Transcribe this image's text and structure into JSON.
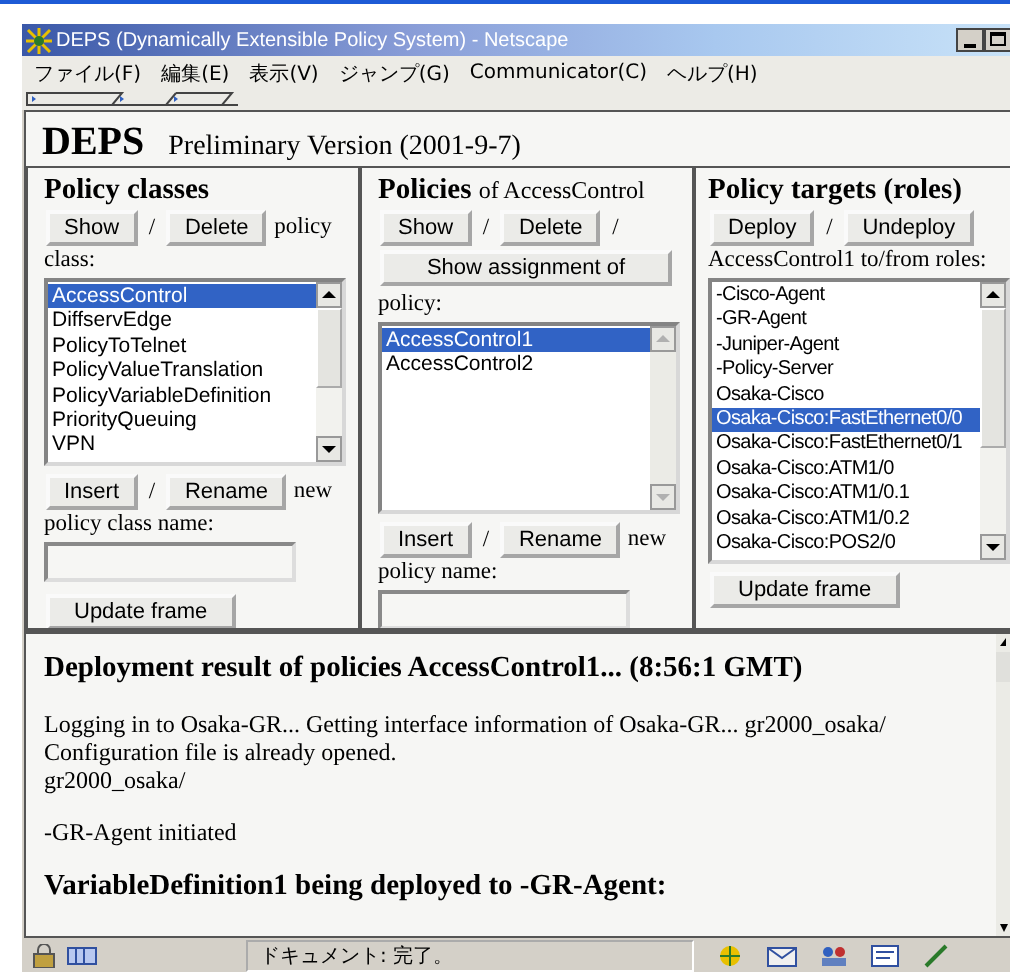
{
  "window": {
    "title": "DEPS (Dynamically Extensible Policy System) - Netscape"
  },
  "menu": [
    "ファイル(F)",
    "編集(E)",
    "表示(V)",
    "ジャンプ(G)",
    "Communicator(C)",
    "ヘルプ(H)"
  ],
  "header": {
    "title": "DEPS",
    "subtitle": "Preliminary Version (2001-9-7)"
  },
  "panels": [
    {
      "title": "Policy classes",
      "items": [
        {
          "kind": "button",
          "text": "Show"
        },
        {
          "kind": "text",
          "text": "/"
        },
        {
          "kind": "button",
          "text": "Delete"
        },
        {
          "kind": "text",
          "text": "policy"
        },
        {
          "kind": "text",
          "text": "class:"
        },
        {
          "kind": "list",
          "disabled": false,
          "items": [
            {
              "text": "AccessControl",
              "selected": true
            },
            {
              "text": "DiffservEdge",
              "selected": false
            },
            {
              "text": "PolicyToTelnet",
              "selected": false
            },
            {
              "text": "PolicyValueTranslation",
              "selected": false
            },
            {
              "text": "PolicyVariableDefinition",
              "selected": false
            },
            {
              "text": "PriorityQueuing",
              "selected": false
            },
            {
              "text": "VPN",
              "selected": false
            }
          ]
        },
        {
          "kind": "button",
          "text": "Insert"
        },
        {
          "kind": "text",
          "text": "/"
        },
        {
          "kind": "button",
          "text": "Rename"
        },
        {
          "kind": "text",
          "text": "new"
        },
        {
          "kind": "text",
          "text": "policy class name:"
        },
        {
          "kind": "field"
        },
        {
          "kind": "block-button",
          "text": "Update frame"
        }
      ]
    },
    {
      "title": "Policies",
      "title_suffix": "of AccessControl",
      "items": [
        {
          "kind": "button",
          "text": "Show"
        },
        {
          "kind": "text",
          "text": "/"
        },
        {
          "kind": "button",
          "text": "Delete"
        },
        {
          "kind": "text",
          "text": "/"
        },
        {
          "kind": "block-button",
          "text": "Show assignment of"
        },
        {
          "kind": "text",
          "text": "policy:"
        },
        {
          "kind": "list",
          "disabled": true,
          "items": [
            {
              "text": "AccessControl1",
              "selected": true
            },
            {
              "text": "AccessControl2",
              "selected": false
            }
          ]
        },
        {
          "kind": "button",
          "text": "Insert"
        },
        {
          "kind": "text",
          "text": "/"
        },
        {
          "kind": "button",
          "text": "Rename"
        },
        {
          "kind": "text",
          "text": "new"
        },
        {
          "kind": "text",
          "text": "policy name:"
        },
        {
          "kind": "field"
        }
      ]
    },
    {
      "title": "Policy targets (roles)",
      "items": [
        {
          "kind": "button",
          "text": "Deploy"
        },
        {
          "kind": "text",
          "text": "/"
        },
        {
          "kind": "button",
          "text": "Undeploy"
        },
        {
          "kind": "text",
          "text": "AccessControl1 to/from roles:"
        },
        {
          "kind": "list",
          "disabled": false,
          "items": [
            {
              "text": "-Cisco-Agent",
              "selected": false
            },
            {
              "text": "-GR-Agent",
              "selected": false
            },
            {
              "text": "-Juniper-Agent",
              "selected": false
            },
            {
              "text": "-Policy-Server",
              "selected": false
            },
            {
              "text": "Osaka-Cisco",
              "selected": false
            },
            {
              "text": "Osaka-Cisco:FastEthernet0/0",
              "selected": true
            },
            {
              "text": "Osaka-Cisco:FastEthernet0/1",
              "selected": false
            },
            {
              "text": "Osaka-Cisco:ATM1/0",
              "selected": false
            },
            {
              "text": "Osaka-Cisco:ATM1/0.1",
              "selected": false
            },
            {
              "text": "Osaka-Cisco:ATM1/0.2",
              "selected": false
            },
            {
              "text": "Osaka-Cisco:POS2/0",
              "selected": false
            }
          ]
        },
        {
          "kind": "block-button",
          "text": "Update frame"
        }
      ]
    }
  ],
  "result": [
    {
      "kind": "heading",
      "text": "Deployment result of policies AccessControl1... (8:56:1 GMT)"
    },
    {
      "kind": "paragraph",
      "lines": [
        "Logging in to Osaka-GR... Getting interface information of Osaka-GR... gr2000_osaka/",
        "Configuration file is already opened.",
        "gr2000_osaka/"
      ]
    },
    {
      "kind": "paragraph",
      "lines": [
        "-GR-Agent initiated"
      ]
    },
    {
      "kind": "heading",
      "text": "VariableDefinition1 being deployed to -GR-Agent:"
    }
  ],
  "status_bar": {
    "text": "ドキュメント: 完了。"
  }
}
